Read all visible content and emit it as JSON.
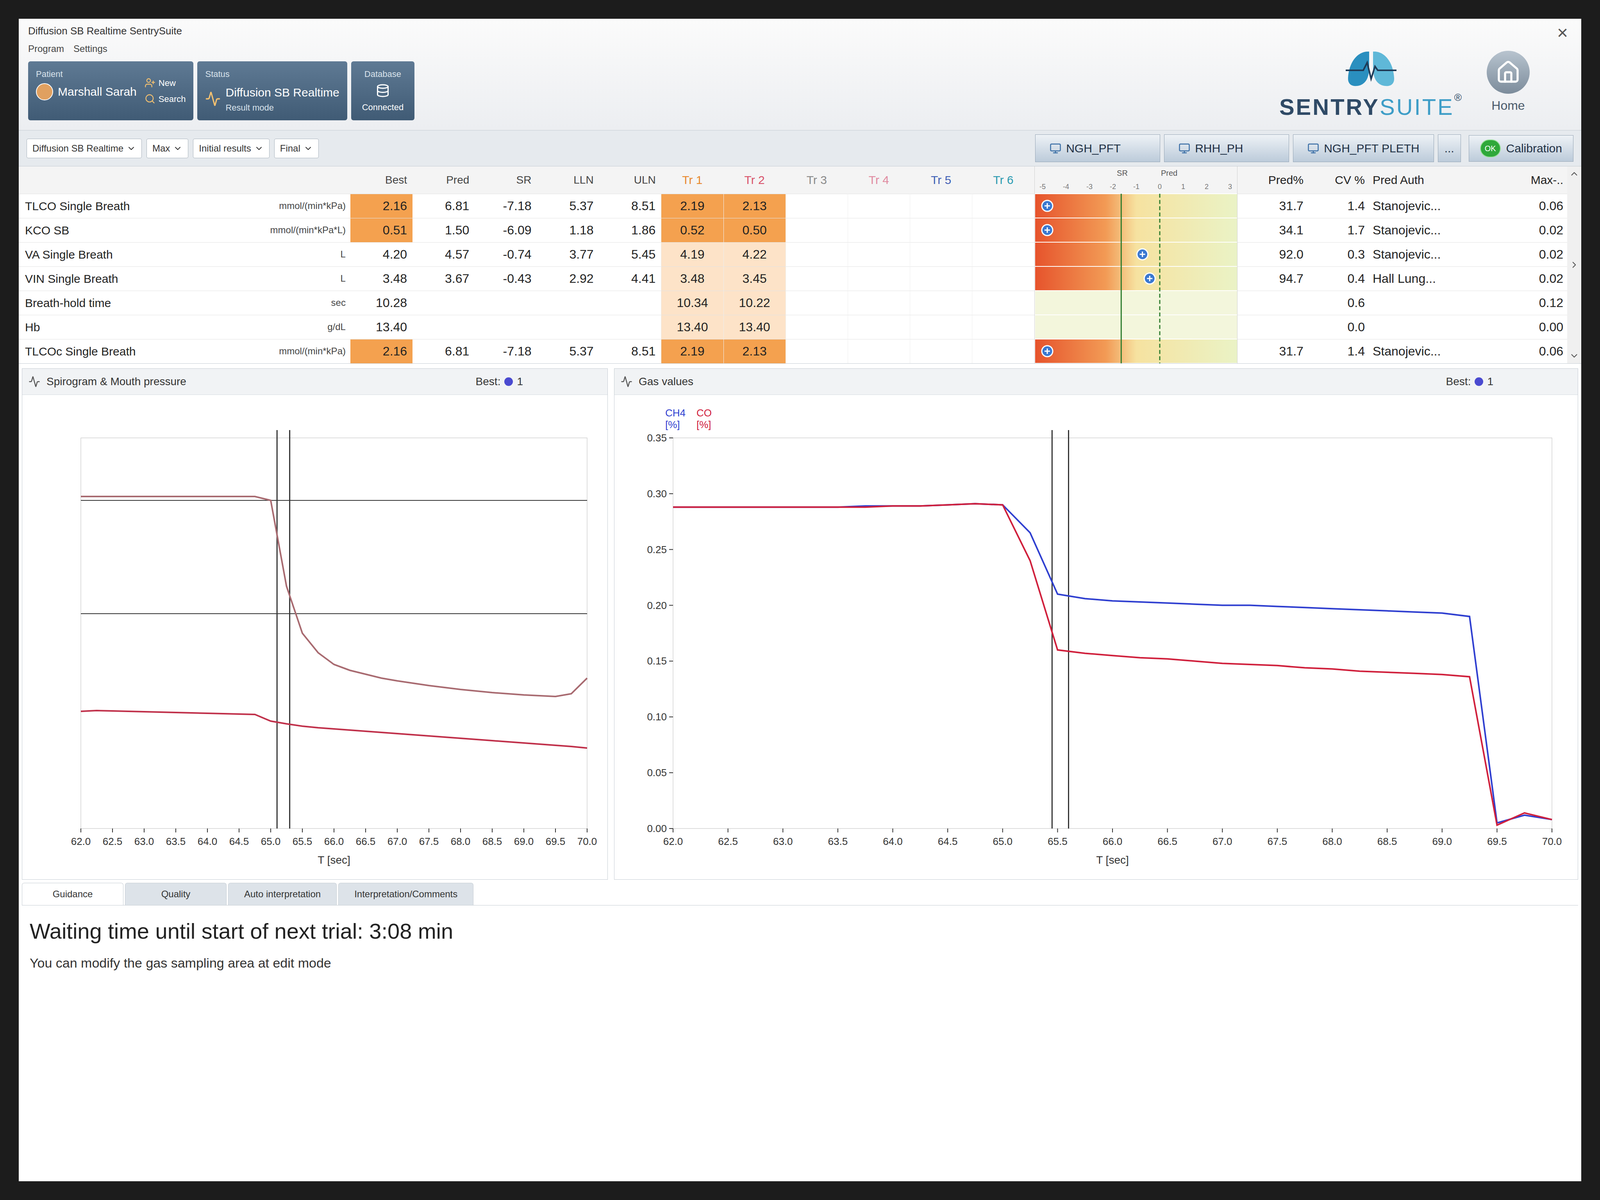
{
  "window": {
    "title": "Diffusion SB Realtime SentrySuite",
    "menu": [
      "Program",
      "Settings"
    ],
    "close": "×"
  },
  "patient": {
    "label": "Patient",
    "name": "Marshall Sarah",
    "actions": [
      "New",
      "Search"
    ]
  },
  "status": {
    "label": "Status",
    "mode": "Diffusion SB Realtime",
    "sub": "Result mode"
  },
  "database": {
    "label": "Database",
    "state": "Connected"
  },
  "brand": {
    "name_a": "SENTRY",
    "name_b": "SUITE",
    "mark": "®"
  },
  "home": {
    "label": "Home"
  },
  "toolbar": {
    "dropdowns": [
      "Diffusion SB Realtime",
      "Max",
      "Initial results",
      "Final"
    ]
  },
  "workspaces": [
    {
      "label": "NGH_PFT",
      "selected": false
    },
    {
      "label": "RHH_PH",
      "selected": false
    },
    {
      "label": "NGH_PFT PLETH",
      "selected": false
    }
  ],
  "more": "...",
  "calibration": {
    "badge": "OK",
    "label": "Calibration"
  },
  "params_table": {
    "columns": [
      "Best",
      "Pred",
      "SR",
      "LLN",
      "ULN"
    ],
    "trials": [
      {
        "label": "Tr 1",
        "color": "#e8892b"
      },
      {
        "label": "Tr 2",
        "color": "#d9536a"
      },
      {
        "label": "Tr 3",
        "color": "#8a8a8a"
      },
      {
        "label": "Tr 4",
        "color": "#e08aa0"
      },
      {
        "label": "Tr 5",
        "color": "#3f5fb5"
      },
      {
        "label": "Tr 6",
        "color": "#2a9ab0"
      }
    ],
    "rows": [
      {
        "name": "TLCO Single Breath",
        "unit": "mmol/(min*kPa)",
        "abnormal": true,
        "best": "2.16",
        "pred": "6.81",
        "sr": "-7.18",
        "lln": "5.37",
        "uln": "8.51",
        "trials": [
          "2.19",
          "2.13",
          "",
          "",
          "",
          ""
        ]
      },
      {
        "name": "KCO SB",
        "unit": "mmol/(min*kPa*L)",
        "abnormal": true,
        "best": "0.51",
        "pred": "1.50",
        "sr": "-6.09",
        "lln": "1.18",
        "uln": "1.86",
        "trials": [
          "0.52",
          "0.50",
          "",
          "",
          "",
          ""
        ]
      },
      {
        "name": "VA Single Breath",
        "unit": "L",
        "abnormal": false,
        "best": "4.20",
        "pred": "4.57",
        "sr": "-0.74",
        "lln": "3.77",
        "uln": "5.45",
        "trials": [
          "4.19",
          "4.22",
          "",
          "",
          "",
          ""
        ]
      },
      {
        "name": "VIN Single Breath",
        "unit": "L",
        "abnormal": false,
        "best": "3.48",
        "pred": "3.67",
        "sr": "-0.43",
        "lln": "2.92",
        "uln": "4.41",
        "trials": [
          "3.48",
          "3.45",
          "",
          "",
          "",
          ""
        ]
      },
      {
        "name": "Breath-hold time",
        "unit": "sec",
        "abnormal": false,
        "best": "10.28",
        "pred": "",
        "sr": "",
        "lln": "",
        "uln": "",
        "trials": [
          "10.34",
          "10.22",
          "",
          "",
          "",
          ""
        ]
      },
      {
        "name": "Hb",
        "unit": "g/dL",
        "abnormal": false,
        "best": "13.40",
        "pred": "",
        "sr": "",
        "lln": "",
        "uln": "",
        "trials": [
          "13.40",
          "13.40",
          "",
          "",
          "",
          ""
        ]
      },
      {
        "name": "TLCOc Single Breath",
        "unit": "mmol/(min*kPa)",
        "abnormal": true,
        "best": "2.16",
        "pred": "6.81",
        "sr": "-7.18",
        "lln": "5.37",
        "uln": "8.51",
        "trials": [
          "2.19",
          "2.13",
          "",
          "",
          "",
          ""
        ]
      }
    ]
  },
  "sr_plot": {
    "title": "SR",
    "pred_label": "Pred",
    "ticks": [
      "-5",
      "-4",
      "-3",
      "-2",
      "-1",
      "0",
      "1",
      "2",
      "3"
    ],
    "lln": -1.645,
    "sr": [
      -7.18,
      -6.09,
      -0.74,
      -0.43,
      null,
      null,
      -7.18
    ]
  },
  "summary_table": {
    "columns": [
      "Pred%",
      "CV %",
      "Pred Auth",
      "Max-.."
    ],
    "rows": [
      [
        "31.7",
        "1.4",
        "Stanojevic...",
        "0.06"
      ],
      [
        "34.1",
        "1.7",
        "Stanojevic...",
        "0.02"
      ],
      [
        "92.0",
        "0.3",
        "Stanojevic...",
        "0.02"
      ],
      [
        "94.7",
        "0.4",
        "Hall Lung...",
        "0.02"
      ],
      [
        "",
        "0.6",
        "",
        "0.12"
      ],
      [
        "",
        "0.0",
        "",
        "0.00"
      ],
      [
        "31.7",
        "1.4",
        "Stanojevic...",
        "0.06"
      ]
    ]
  },
  "charts": [
    {
      "title": "Spirogram & Mouth pressure",
      "legend": "Best:",
      "best": "1",
      "x_label": "T [sec]",
      "x_domain": [
        62,
        70
      ],
      "y_domain": [
        0,
        1
      ],
      "x_ticks": [
        "62.0",
        "62.5",
        "63.0",
        "63.5",
        "64.0",
        "64.5",
        "65.0",
        "65.5",
        "66.0",
        "66.5",
        "67.0",
        "67.5",
        "68.0",
        "68.5",
        "69.0",
        "69.5",
        "70.0"
      ],
      "y_ticks": [],
      "reference_lines": [
        0.84,
        0.55
      ],
      "cursors": [
        65.1,
        65.3
      ],
      "x": [
        62.0,
        62.25,
        62.5,
        62.75,
        63.0,
        63.25,
        63.5,
        63.75,
        64.0,
        64.25,
        64.5,
        64.75,
        65.0,
        65.25,
        65.5,
        65.75,
        66.0,
        66.25,
        66.5,
        66.75,
        67.0,
        67.25,
        67.5,
        67.75,
        68.0,
        68.25,
        68.5,
        68.75,
        69.0,
        69.25,
        69.5,
        69.75,
        70.0
      ],
      "series": [
        {
          "name": "",
          "unit": "",
          "color": "#a86a70",
          "values": [
            0.85,
            0.85,
            0.85,
            0.85,
            0.85,
            0.85,
            0.85,
            0.85,
            0.85,
            0.85,
            0.85,
            0.85,
            0.84,
            0.62,
            0.5,
            0.45,
            0.42,
            0.405,
            0.395,
            0.385,
            0.378,
            0.372,
            0.366,
            0.361,
            0.356,
            0.352,
            0.348,
            0.345,
            0.342,
            0.34,
            0.338,
            0.345,
            0.385
          ]
        },
        {
          "name": "",
          "unit": "",
          "color": "#c0304a",
          "values": [
            0.3,
            0.302,
            0.301,
            0.3,
            0.299,
            0.298,
            0.297,
            0.296,
            0.295,
            0.294,
            0.293,
            0.292,
            0.275,
            0.268,
            0.262,
            0.258,
            0.255,
            0.252,
            0.249,
            0.246,
            0.243,
            0.24,
            0.237,
            0.234,
            0.231,
            0.228,
            0.225,
            0.222,
            0.219,
            0.216,
            0.213,
            0.21,
            0.206
          ]
        }
      ]
    },
    {
      "title": "Gas values",
      "legend": "Best:",
      "best": "1",
      "x_label": "T [sec]",
      "x_domain": [
        62,
        70
      ],
      "y_domain": [
        0,
        0.35
      ],
      "x_ticks": [
        "62.0",
        "62.5",
        "63.0",
        "63.5",
        "64.0",
        "64.5",
        "65.0",
        "65.5",
        "66.0",
        "66.5",
        "67.0",
        "67.5",
        "68.0",
        "68.5",
        "69.0",
        "69.5",
        "70.0"
      ],
      "y_ticks": [
        "0.00",
        "0.05",
        "0.10",
        "0.15",
        "0.20",
        "0.25",
        "0.30",
        "0.35"
      ],
      "reference_lines": [],
      "cursors": [
        65.45,
        65.6
      ],
      "x": [
        62.0,
        62.25,
        62.5,
        62.75,
        63.0,
        63.25,
        63.5,
        63.75,
        64.0,
        64.25,
        64.5,
        64.75,
        65.0,
        65.25,
        65.5,
        65.75,
        66.0,
        66.25,
        66.5,
        66.75,
        67.0,
        67.25,
        67.5,
        67.75,
        68.0,
        68.25,
        68.5,
        68.75,
        69.0,
        69.25,
        69.5,
        69.75,
        70.0
      ],
      "series": [
        {
          "name": "CH4",
          "unit": "[%]",
          "color": "#2f3fd0",
          "values": [
            0.288,
            0.288,
            0.288,
            0.288,
            0.288,
            0.288,
            0.288,
            0.289,
            0.289,
            0.289,
            0.29,
            0.291,
            0.29,
            0.265,
            0.21,
            0.206,
            0.204,
            0.203,
            0.202,
            0.201,
            0.2,
            0.2,
            0.199,
            0.198,
            0.197,
            0.196,
            0.195,
            0.194,
            0.193,
            0.19,
            0.005,
            0.012,
            0.008
          ]
        },
        {
          "name": "CO",
          "unit": "[%]",
          "color": "#d0203c",
          "values": [
            0.288,
            0.288,
            0.288,
            0.288,
            0.288,
            0.288,
            0.288,
            0.288,
            0.289,
            0.289,
            0.29,
            0.291,
            0.29,
            0.24,
            0.16,
            0.157,
            0.155,
            0.153,
            0.152,
            0.15,
            0.148,
            0.147,
            0.146,
            0.144,
            0.143,
            0.141,
            0.14,
            0.139,
            0.138,
            0.136,
            0.003,
            0.014,
            0.008
          ]
        }
      ]
    }
  ],
  "bottom_tabs": [
    {
      "label": "Guidance",
      "selected": true
    },
    {
      "label": "Quality",
      "selected": false
    },
    {
      "label": "Auto interpretation",
      "selected": false
    },
    {
      "label": "Interpretation/Comments",
      "selected": false
    }
  ],
  "message": {
    "main": "Waiting time until start of next trial: 3:08 min",
    "hint": "You can modify the gas sampling area at edit mode"
  }
}
